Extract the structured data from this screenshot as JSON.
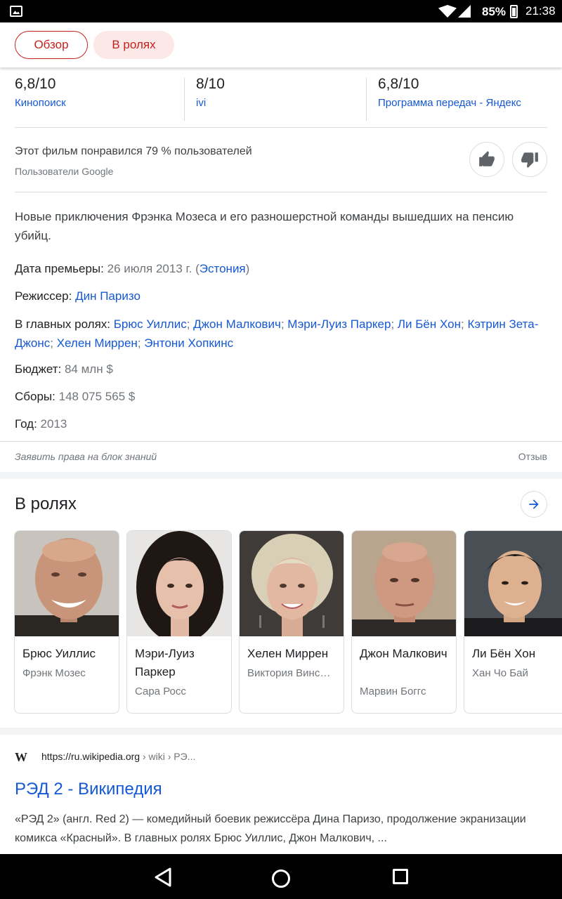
{
  "status_bar": {
    "battery": "85%",
    "time": "21:38"
  },
  "tabs": {
    "overview": "Обзор",
    "cast": "В ролях"
  },
  "ratings": [
    {
      "score": "6,8/10",
      "source": "Кинопоиск"
    },
    {
      "score": "8/10",
      "source": "ivi"
    },
    {
      "score": "6,8/10",
      "source": "Программа передач - Яндекс"
    }
  ],
  "likes": {
    "text": "Этот фильм понравился 79 % пользователей",
    "source": "Пользователи Google"
  },
  "description": "Новые приключения Фрэнка Мозеса и его разношерстной команды вышедших на пенсию убийц.",
  "facts": {
    "premiere_label": "Дата премьеры:",
    "premiere_value": "26 июля 2013 г.",
    "premiere_country": "Эстония",
    "director_label": "Режиссер:",
    "director_value": "Дин Паризо",
    "cast_label": "В главных ролях:",
    "cast_list": [
      "Брюс Уиллис",
      "Джон Малкович",
      "Мэри-Луиз Паркер",
      "Ли Бён Хон",
      "Кэтрин Зета-Джонс",
      "Хелен Миррен",
      "Энтони Хопкинс"
    ],
    "budget_label": "Бюджет:",
    "budget_value": "84 млн $",
    "boxoffice_label": "Сборы:",
    "boxoffice_value": "148 075 565 $",
    "year_label": "Год:",
    "year_value": "2013"
  },
  "claim": {
    "label": "Заявить права на блок знаний",
    "feedback": "Отзыв"
  },
  "cast_section": {
    "title": "В ролях",
    "cards": [
      {
        "name": "Брюс Уиллис",
        "role": "Фрэнк Мозес"
      },
      {
        "name": "Мэри-Луиз Паркер",
        "role": "Сара Росс"
      },
      {
        "name": "Хелен Миррен",
        "role": "Виктория Винс…"
      },
      {
        "name": "Джон Малкович",
        "role": "Марвин Боггс"
      },
      {
        "name": "Ли Бён Хон",
        "role": "Хан Чо Бай"
      }
    ]
  },
  "wiki": {
    "icon": "W",
    "url": "https://ru.wikipedia.org",
    "crumb": " › wiki › РЭ...",
    "title": "РЭД 2 - Википедия",
    "snippet": "«РЭД 2» (англ. Red 2) — комедийный боевик режиссёра Дина Паризо, продолжение экранизации комикса «Красный». В главных ролях Брюс Уиллис, Джон Малкович, ..."
  },
  "colors": {
    "accent": "#c5221f",
    "link": "#1558d6",
    "muted": "#70757a"
  },
  "icons": [
    "image-icon",
    "wifi-icon",
    "signal-icon",
    "battery-icon",
    "thumbs-up-icon",
    "thumbs-down-icon",
    "arrow-right-icon",
    "wikipedia-icon",
    "back-icon",
    "home-icon",
    "recents-icon"
  ]
}
